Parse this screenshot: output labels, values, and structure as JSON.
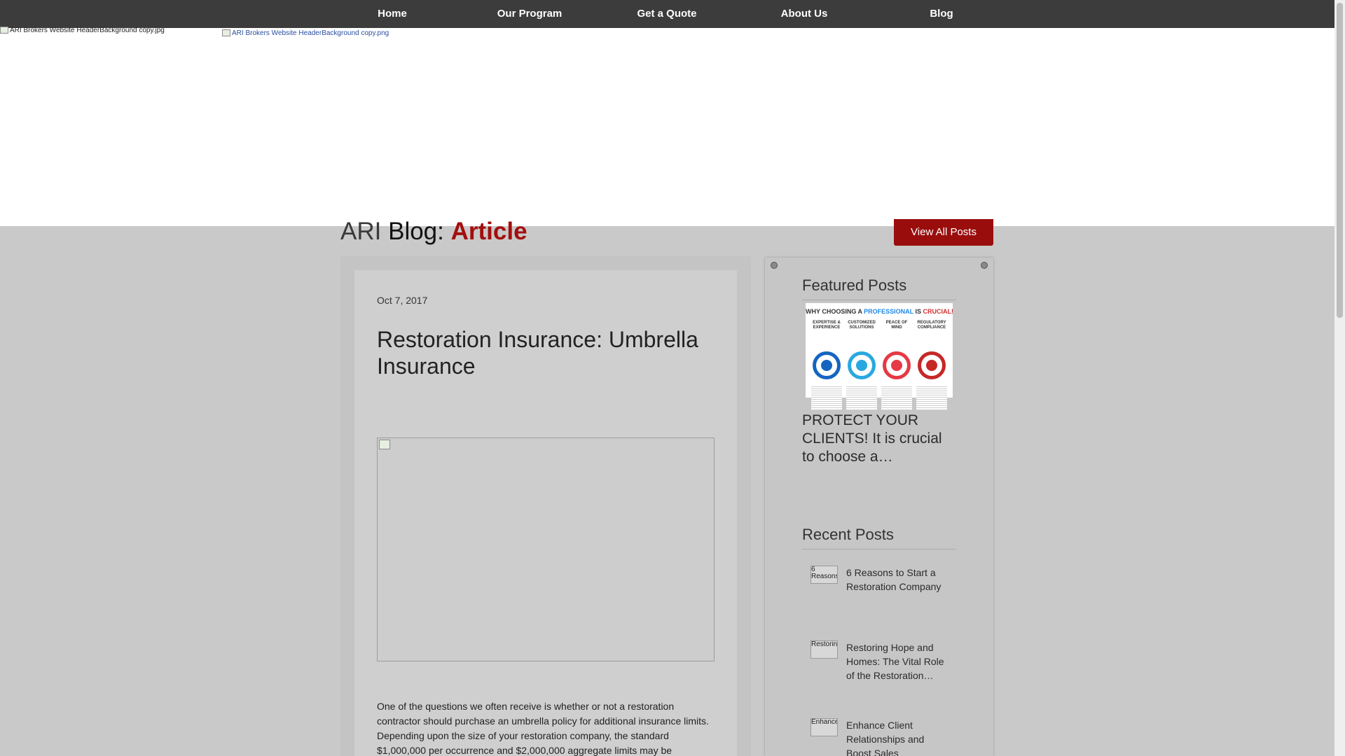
{
  "nav": {
    "items": [
      {
        "label": "Home"
      },
      {
        "label": "Our Program"
      },
      {
        "label": "Get a Quote"
      },
      {
        "label": "About Us"
      },
      {
        "label": "Blog"
      }
    ]
  },
  "header": {
    "broken_image_1": "ARI Brokers Website HeaderBackground copy.jpg",
    "broken_image_2": "ARI Brokers Website HeaderBackground copy.png"
  },
  "blog_heading": {
    "ari": "ARI",
    "blog": "Blog:",
    "article": "Article"
  },
  "view_all_label": "View All Posts",
  "post": {
    "date": "Oct 7, 2017",
    "title": "Restoration Insurance: Umbrella Insurance",
    "body": "One of the questions we often receive is whether or not a restoration contractor should purchase an umbrella policy for additional insurance limits. Depending upon the size of your restoration company, the standard $1,000,000 per occurrence and $2,000,000 aggregate limits may be"
  },
  "sidebar": {
    "featured_heading": "Featured Posts",
    "featured_image": {
      "banner_start": "WHY CHOOSING A ",
      "banner_pro": "PROFESSIONAL",
      "banner_mid": " IS ",
      "banner_end": "CRUCIAL!",
      "labels": [
        "EXPERTISE & EXPERIENCE",
        "CUSTOMIZED SOLUTIONS",
        "PEACE OF MIND",
        "REGULATORY COMPLIANCE"
      ]
    },
    "featured_title": "PROTECT YOUR CLIENTS! It is crucial to choose a…",
    "recent_heading": "Recent Posts",
    "recent": [
      {
        "thumb_alt": "6 Reasons",
        "title": "6 Reasons to Start a Restoration Company"
      },
      {
        "thumb_alt": "Restoring",
        "title": "Restoring Hope and Homes: The Vital Role of the Restoration…"
      },
      {
        "thumb_alt": "Enhance",
        "title": "Enhance Client Relationships and Boost Sales"
      }
    ]
  },
  "colors": {
    "nav_bg": "#3c3c3c",
    "accent_red": "#9a0d0d",
    "article_red": "#a40e0e",
    "page_bg": "#c9c9c9"
  }
}
